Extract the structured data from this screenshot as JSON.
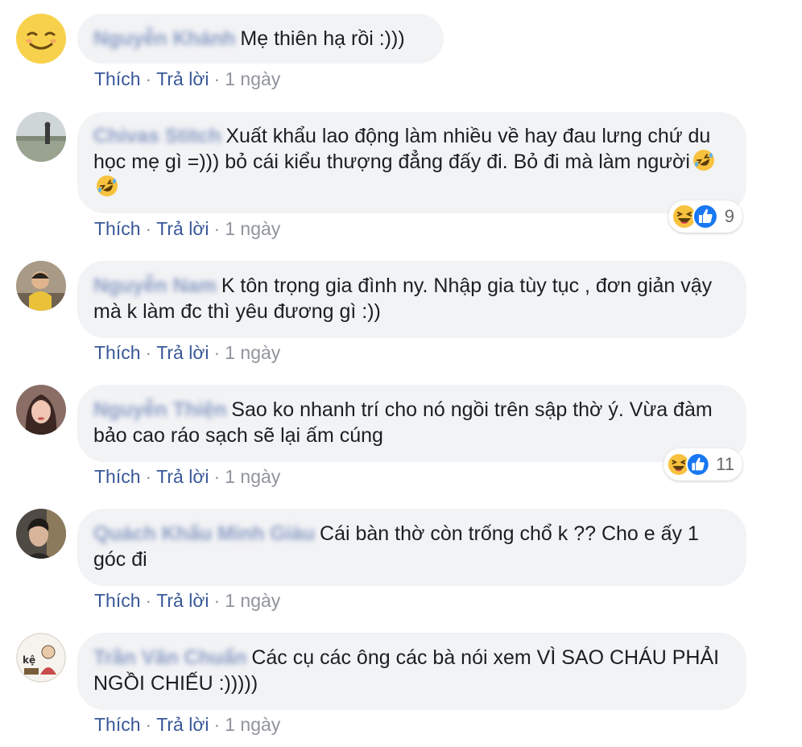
{
  "comments": [
    {
      "author": "Nguyễn Khánh",
      "text": "Mẹ thiên hạ rồi :)))",
      "like": "Thích",
      "reply": "Trả lời",
      "time": "1 ngày"
    },
    {
      "author": "Chivas Stitch",
      "text": "Xuất khẩu lao động làm nhiều về hay đau lưng chứ du học mẹ gì =))) bỏ cái kiểu thượng đẳng đấy đi. Bỏ đi mà làm người",
      "like": "Thích",
      "reply": "Trả lời",
      "time": "1 ngày",
      "reaction_count": "9"
    },
    {
      "author": "Nguyễn Nam",
      "text": "K tôn trọng gia đình ny. Nhập gia tùy tục , đơn giản vậy mà k làm đc thì yêu đương gì :))",
      "like": "Thích",
      "reply": "Trả lời",
      "time": "1 ngày"
    },
    {
      "author": "Nguyễn Thiện",
      "text": "Sao ko nhanh trí cho nó ngồi trên sập thờ ý. Vừa đàm bảo cao ráo sạch sẽ lại ấm cúng",
      "like": "Thích",
      "reply": "Trả lời",
      "time": "1 ngày",
      "reaction_count": "11"
    },
    {
      "author": "Quách Khấu Minh Giàu",
      "text": "Cái bàn thờ còn trống chổ k ?? Cho e ấy 1 góc đi",
      "like": "Thích",
      "reply": "Trả lời",
      "time": "1 ngày"
    },
    {
      "author": "Trần Văn Chuẩn",
      "text": "Các cụ các ông các bà nói xem VÌ SAO CHÁU PHẢI NGỒI CHIẾU :)))))",
      "like": "Thích",
      "reply": "Trả lời",
      "time": "1 ngày",
      "avatar_text": "kệ"
    }
  ],
  "separator": "·",
  "colors": {
    "link": "#385898",
    "bubble": "#f2f3f5",
    "meta": "#90949c",
    "like_blue": "#1877f2",
    "haha_yellow": "#f7c23e"
  },
  "icons": {
    "inline_emoji": "rolling-laughing-emoji-icon",
    "haha": "haha-reaction-icon",
    "like": "like-reaction-icon"
  }
}
